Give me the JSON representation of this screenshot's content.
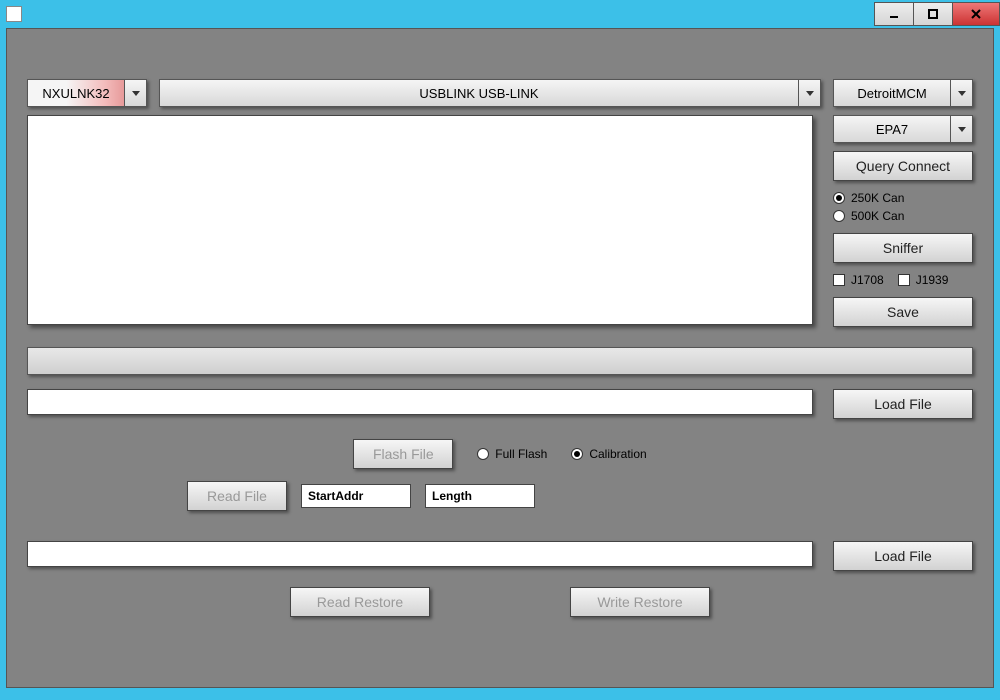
{
  "titlebar": {
    "app_icon": "app-icon"
  },
  "comboAdapter": {
    "value": "NXULNK32"
  },
  "comboDevice": {
    "value": "USBLINK USB-LINK"
  },
  "comboModule": {
    "value": "DetroitMCM"
  },
  "comboEpa": {
    "value": "EPA7"
  },
  "buttons": {
    "query_connect": "Query Connect",
    "sniffer": "Sniffer",
    "save": "Save",
    "load_file_1": "Load File",
    "load_file_2": "Load File",
    "flash_file": "Flash File",
    "read_file": "Read File",
    "read_restore": "Read Restore",
    "write_restore": "Write Restore"
  },
  "radios": {
    "can250": "250K Can",
    "can500": "500K Can",
    "full_flash": "Full Flash",
    "calibration": "Calibration"
  },
  "checks": {
    "j1708": "J1708",
    "j1939": "J1939"
  },
  "inputs": {
    "start_addr_placeholder": "StartAddr",
    "length_placeholder": "Length"
  }
}
